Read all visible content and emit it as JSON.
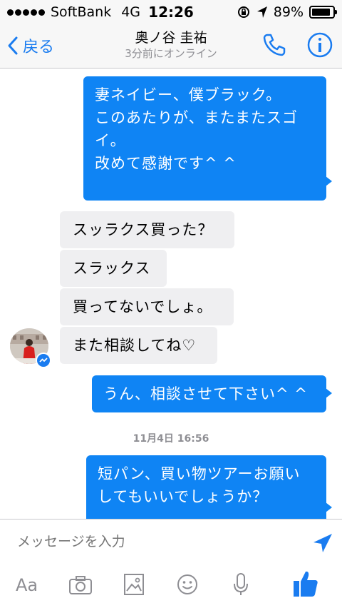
{
  "status_bar": {
    "carrier": "SoftBank",
    "network": "4G",
    "time": "12:26",
    "battery": "89%",
    "battery_level": 0.89
  },
  "nav": {
    "back_label": "戻る",
    "title": "奥ノ谷 圭祐",
    "subtitle": "3分前にオンライン"
  },
  "messages": {
    "m1_lines": [
      "妻ネイビー、僕ブラック。",
      "このあたりが、またまたスゴ",
      "イ。",
      "改めて感謝です^ ^"
    ],
    "m2": "スッラクス買った？",
    "m3": "スラックス",
    "m4": "買ってないでしょ。",
    "m5": "また相談してね♡",
    "m6": "うん、相談させて下さい^ ^",
    "timestamp": "11月4日 16:56",
    "m7_lines": [
      "短パン、買い物ツアーお願い",
      "してもいいでしょうか？"
    ]
  },
  "composer": {
    "placeholder": "メッセージを入力",
    "aa_label": "Aa"
  },
  "colors": {
    "accent": "#1a7cf0",
    "outgoing_bubble": "#0f84f4",
    "incoming_bubble": "#efeff1"
  }
}
